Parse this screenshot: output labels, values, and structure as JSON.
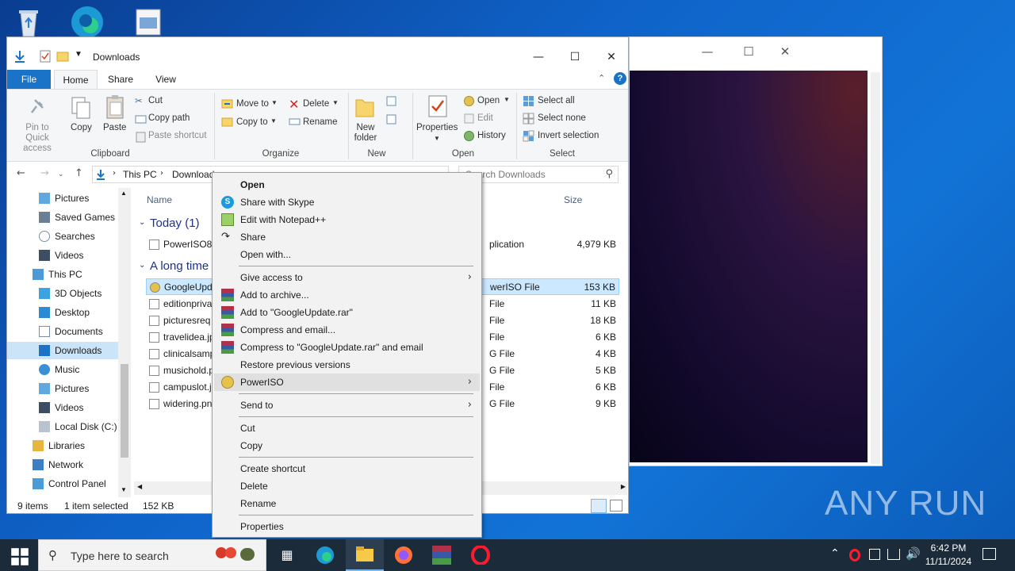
{
  "explorer": {
    "title": "Downloads",
    "tabs": {
      "file": "File",
      "home": "Home",
      "share": "Share",
      "view": "View"
    },
    "ribbon": {
      "pin": "Pin to Quick access",
      "copy": "Copy",
      "paste": "Paste",
      "cut": "Cut",
      "copy_path": "Copy path",
      "paste_shortcut": "Paste shortcut",
      "clipboard": "Clipboard",
      "move_to": "Move to",
      "copy_to": "Copy to",
      "delete": "Delete",
      "rename": "Rename",
      "organize": "Organize",
      "new_folder": "New folder",
      "new": "New",
      "properties": "Properties",
      "open": "Open",
      "edit": "Edit",
      "history": "History",
      "open_group": "Open",
      "select_all": "Select all",
      "select_none": "Select none",
      "invert_selection": "Invert selection",
      "select_group": "Select"
    },
    "address": {
      "this_pc": "This PC",
      "downloads": "Downloads"
    },
    "search_placeholder": "Search Downloads",
    "nav": {
      "items": [
        "Pictures",
        "Saved Games",
        "Searches",
        "Videos",
        "This PC",
        "3D Objects",
        "Desktop",
        "Documents",
        "Downloads",
        "Music",
        "Pictures",
        "Videos",
        "Local Disk (C:)",
        "Libraries",
        "Network",
        "Control Panel"
      ]
    },
    "columns": {
      "name": "Name",
      "size": "Size"
    },
    "groups": {
      "today": "Today (1)",
      "long_time": "A long time"
    },
    "files": [
      {
        "name": "PowerISO8.",
        "type": "plication",
        "size": "4,979 KB"
      },
      {
        "name": "GoogleUpd",
        "type": "werISO File",
        "size": "153 KB"
      },
      {
        "name": "editionpriva",
        "type": "File",
        "size": "11 KB"
      },
      {
        "name": "picturesreq",
        "type": "File",
        "size": "18 KB"
      },
      {
        "name": "travelidea.jp",
        "type": "File",
        "size": "6 KB"
      },
      {
        "name": "clinicalsamp",
        "type": "G File",
        "size": "4 KB"
      },
      {
        "name": "musichold.p",
        "type": "G File",
        "size": "5 KB"
      },
      {
        "name": "campuslot.j",
        "type": "File",
        "size": "6 KB"
      },
      {
        "name": "widering.pn",
        "type": "G File",
        "size": "9 KB"
      }
    ],
    "status": {
      "count": "9 items",
      "selected": "1 item selected",
      "size": "152 KB"
    }
  },
  "context_menu": {
    "open": "Open",
    "share_skype": "Share with Skype",
    "edit_npp": "Edit with Notepad++",
    "share": "Share",
    "open_with": "Open with...",
    "give_access": "Give access to",
    "add_archive": "Add to archive...",
    "add_rar": "Add to \"GoogleUpdate.rar\"",
    "compress_email": "Compress and email...",
    "compress_rar_email": "Compress to \"GoogleUpdate.rar\" and email",
    "restore": "Restore previous versions",
    "poweriso": "PowerISO",
    "send_to": "Send to",
    "cut": "Cut",
    "copy": "Copy",
    "create_shortcut": "Create shortcut",
    "delete": "Delete",
    "rename": "Rename",
    "properties": "Properties"
  },
  "taskbar": {
    "search_placeholder": "Type here to search",
    "time": "6:42 PM",
    "date": "11/11/2024"
  },
  "watermark": "ANY RUN"
}
